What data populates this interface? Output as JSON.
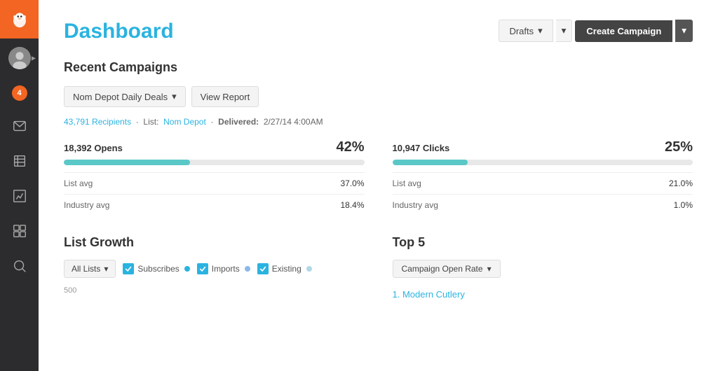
{
  "sidebar": {
    "logo_alt": "Mailchimp",
    "badge": "4",
    "nav_items": [
      "envelope-icon",
      "document-icon",
      "chart-icon",
      "table-icon",
      "search-icon"
    ]
  },
  "header": {
    "title": "Dashboard",
    "drafts_label": "Drafts",
    "create_label": "Create Campaign"
  },
  "recent_campaigns": {
    "section_title": "Recent Campaigns",
    "campaign_select_label": "Nom Depot Daily Deals",
    "view_report_label": "View Report",
    "meta_recipients": "43,791 Recipients",
    "meta_list_label": "List:",
    "meta_list_name": "Nom Depot",
    "meta_delivered_label": "Delivered:",
    "meta_delivered_value": "2/27/14 4:00AM"
  },
  "stats": {
    "opens": {
      "label": "18,392 Opens",
      "percent": "42%",
      "fill_width": 42,
      "total_width": 100,
      "list_avg_label": "List avg",
      "list_avg_value": "37.0%",
      "industry_avg_label": "Industry avg",
      "industry_avg_value": "18.4%"
    },
    "clicks": {
      "label": "10,947 Clicks",
      "percent": "25%",
      "fill_width": 25,
      "total_width": 100,
      "list_avg_label": "List avg",
      "list_avg_value": "21.0%",
      "industry_avg_label": "Industry avg",
      "industry_avg_value": "1.0%"
    }
  },
  "list_growth": {
    "title": "List Growth",
    "all_lists_label": "All Lists",
    "subscribes_label": "Subscribes",
    "imports_label": "Imports",
    "existing_label": "Existing",
    "subscribes_color": "#2ab3e0",
    "imports_color": "#8bb8e8",
    "existing_color": "#b0d8e8",
    "chart_y_label": "500"
  },
  "top5": {
    "title": "Top 5",
    "open_rate_label": "Campaign Open Rate",
    "items": [
      {
        "num": "1.",
        "name": "Modern Cutlery"
      }
    ]
  }
}
